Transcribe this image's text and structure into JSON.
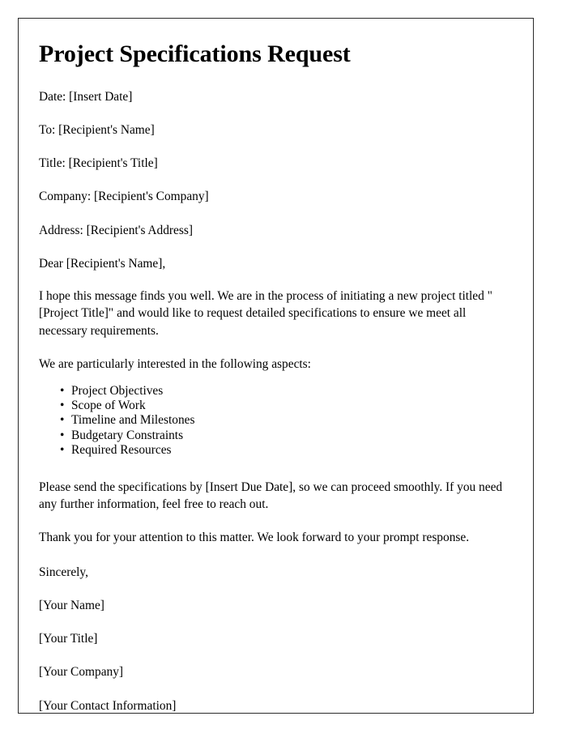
{
  "document": {
    "title": "Project Specifications Request",
    "header_fields": [
      "Date: [Insert Date]",
      "To: [Recipient's Name]",
      "Title: [Recipient's Title]",
      "Company: [Recipient's Company]",
      "Address: [Recipient's Address]"
    ],
    "salutation": "Dear [Recipient's Name],",
    "paragraph_intro": "I hope this message finds you well. We are in the process of initiating a new project titled \"[Project Title]\" and would like to request detailed specifications to ensure we meet all necessary requirements.",
    "paragraph_aspects_lead": "We are particularly interested in the following aspects:",
    "aspects": [
      "Project Objectives",
      "Scope of Work",
      "Timeline and Milestones",
      "Budgetary Constraints",
      "Required Resources"
    ],
    "paragraph_due_date": "Please send the specifications by [Insert Due Date], so we can proceed smoothly. If you need any further information, feel free to reach out.",
    "paragraph_thanks": "Thank you for your attention to this matter. We look forward to your prompt response.",
    "closing": "Sincerely,",
    "signature_block": [
      "[Your Name]",
      "[Your Title]",
      "[Your Company]",
      "[Your Contact Information]"
    ]
  },
  "style": {
    "text_color": "#000000",
    "page_background": "#ffffff",
    "border_color": "#2b2b2b"
  }
}
